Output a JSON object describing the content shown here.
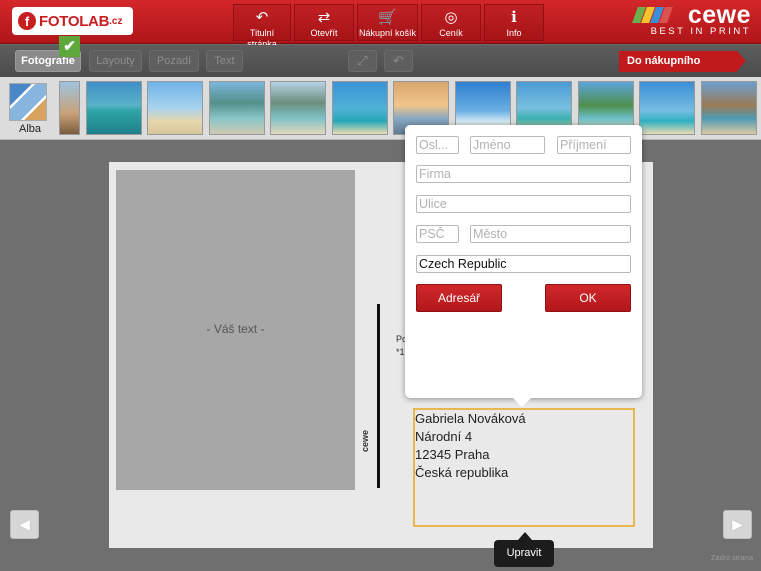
{
  "header": {
    "logo_text": "FOTOLAB",
    "logo_tld": ".cz",
    "nav": [
      {
        "label": "Titulní stránka",
        "icon": "↶"
      },
      {
        "label": "Otevřít",
        "icon": "⇄"
      },
      {
        "label": "Nákupní košík",
        "icon": "🛒"
      },
      {
        "label": "Ceník",
        "icon": "◎"
      },
      {
        "label": "Info",
        "icon": "i"
      }
    ],
    "brand_name": "cewe",
    "brand_tagline": "BEST IN PRINT",
    "brand_colors": [
      "#6ab04c",
      "#f4c430",
      "#3a8fd8",
      "#d9534f"
    ]
  },
  "toolbar": {
    "tabs": [
      "Fotografie",
      "Layouty",
      "Pozadí",
      "Text"
    ],
    "fit_icon": "⤢",
    "undo_icon": "↶",
    "cart_label": "Do nákupního košíku"
  },
  "strip": {
    "albums_label": "Alba",
    "check_icon": "✔"
  },
  "canvas": {
    "photo_placeholder": "- Váš text -",
    "side_text_line1": "Po",
    "side_text_line2": "*1",
    "vertical_brand": "cewe",
    "address": [
      "Gabriela Nováková",
      "Národní 4",
      "12345 Praha",
      "Česká republika"
    ],
    "edit_label": "Upravit",
    "prev_icon": "◀",
    "next_icon": "▶",
    "page_label": "Zadní strana"
  },
  "form": {
    "title_placeholder": "Osl...",
    "first_name_placeholder": "Jméno",
    "last_name_placeholder": "Příjmení",
    "company_placeholder": "Firma",
    "street_placeholder": "Ulice",
    "zip_placeholder": "PSČ",
    "city_placeholder": "Město",
    "country_value": "Czech Republic",
    "address_book_label": "Adresář",
    "ok_label": "OK"
  }
}
